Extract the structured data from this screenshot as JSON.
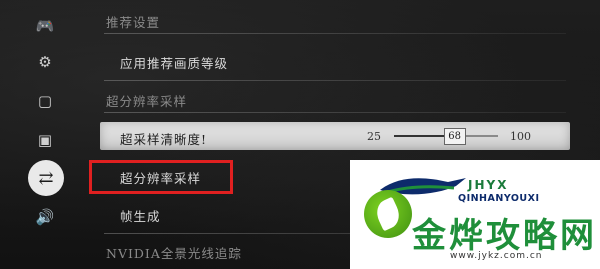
{
  "sidebar": {
    "icons": [
      {
        "name": "gamepad-icon",
        "glyph": "🎮",
        "active": false
      },
      {
        "name": "gear-icon",
        "glyph": "⚙",
        "active": false
      },
      {
        "name": "display-icon",
        "glyph": "▢",
        "active": false
      },
      {
        "name": "monitor-icon",
        "glyph": "▣",
        "active": false
      },
      {
        "name": "sliders-icon",
        "glyph": "⇄",
        "active": true
      },
      {
        "name": "speaker-icon",
        "glyph": "🔊",
        "active": false
      }
    ]
  },
  "settings": {
    "recommended_header": "推荐设置",
    "apply_recommended": "应用推荐画质等级",
    "superres_header": "超分辨率采样",
    "sharpness": {
      "label": "超采样清晰度!",
      "min": "25",
      "value": 68,
      "max": "100"
    },
    "superres_sampling": "超分辨率采样",
    "frame_generation": "帧生成",
    "raytracing_header": "NVIDIA全景光线追踪"
  },
  "watermark": {
    "tag": "JHYX",
    "pinyin": "QINHANYOUXI",
    "name": "金烨攻略网",
    "url": "www.jykz.com.cn"
  },
  "colors": {
    "highlight": "#e02020",
    "logo_green": "#1f8f3a",
    "logo_blue": "#0d2b6b"
  }
}
